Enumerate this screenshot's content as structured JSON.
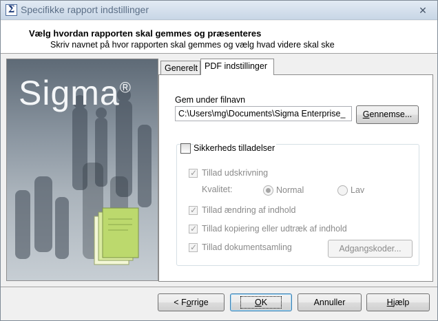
{
  "window": {
    "title": "Specifikke rapport indstillinger",
    "app_icon_glyph": "Σ",
    "close_glyph": "✕"
  },
  "header": {
    "title": "Vælg hvordan rapporten skal gemmes og præsenteres",
    "subtitle": "Skriv navnet på hvor rapporten skal gemmes og vælg hvad videre skal ske"
  },
  "image_panel": {
    "logo_text": "Sigma",
    "logo_mark": "®"
  },
  "tabs": [
    {
      "label": "Generelt",
      "active": false
    },
    {
      "label": "PDF indstillinger",
      "active": true
    }
  ],
  "pdf": {
    "save_label": "Gem under filnavn",
    "filename_value": "C:\\Users\\mg\\Documents\\Sigma Enterprise_",
    "browse_prefix": "G",
    "browse_rest": "ennemse...",
    "security": {
      "label": "Sikkerheds tilladelser",
      "checked": false,
      "options": {
        "print_label": "Tillad udskrivning",
        "quality_label": "Kvalitet:",
        "normal_label": "Normal",
        "low_label": "Lav",
        "modify_label": "Tillad ændring af indhold",
        "copy_label": "Tillad kopiering eller udtræk af indhold",
        "assembly_label": "Tillad dokumentsamling",
        "passwords_button": "Adgangskoder..."
      }
    }
  },
  "footer": {
    "prev_before": "< F",
    "prev_underline": "o",
    "prev_after": "rrige",
    "ok_underline": "O",
    "ok_after": "K",
    "cancel": "Annuller",
    "help_underline": "H",
    "help_after": "jælp"
  }
}
